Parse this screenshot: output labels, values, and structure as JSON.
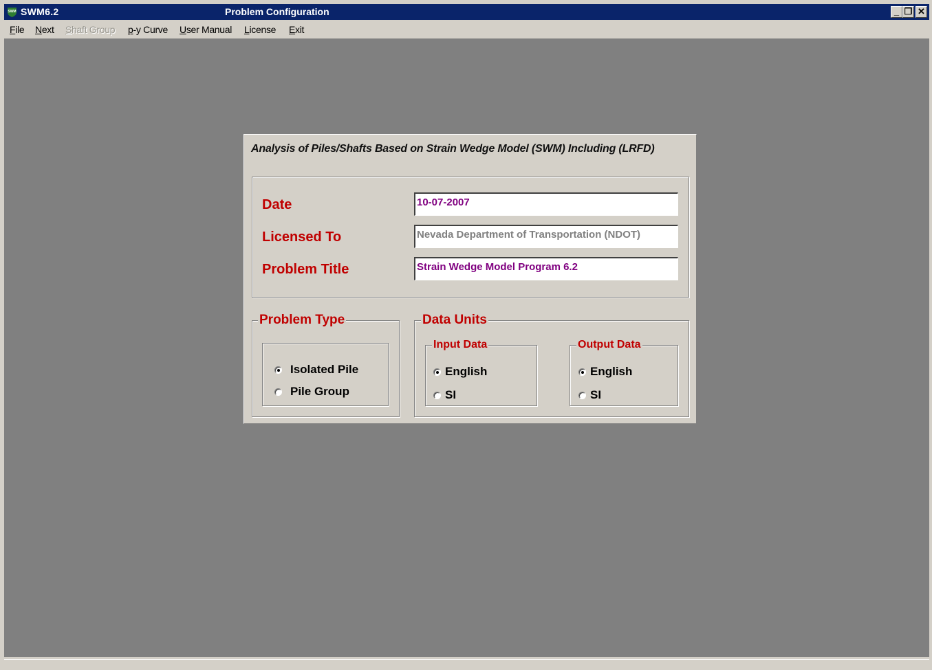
{
  "window": {
    "app_name": "SWM6.2",
    "icon_text": "SWM",
    "title": "Problem Configuration",
    "controls": {
      "minimize": "_",
      "restore": "❐",
      "close": "✕"
    }
  },
  "menu": {
    "items": [
      {
        "label": "File",
        "accel": "F",
        "rest": "ile",
        "enabled": true
      },
      {
        "label": "Next",
        "accel": "N",
        "rest": "ext",
        "enabled": true
      },
      {
        "label": "Shaft Group",
        "accel": "S",
        "rest": "haft Group",
        "enabled": false
      },
      {
        "label": "p-y Curve",
        "accel": "p",
        "rest": "-y Curve",
        "enabled": true
      },
      {
        "label": "User Manual",
        "accel": "U",
        "rest": "ser Manual",
        "enabled": true
      },
      {
        "label": "License",
        "accel": "L",
        "rest": "icense",
        "enabled": true
      },
      {
        "label": "Exit",
        "accel": "E",
        "rest": "xit",
        "enabled": true
      }
    ]
  },
  "form": {
    "heading": "Analysis of Piles/Shafts Based on Strain Wedge Model (SWM) Including (LRFD)",
    "date_label": "Date",
    "date_value": "10-07-2007",
    "licensed_label": "Licensed To",
    "licensed_value": "Nevada Department of Transportation (NDOT)",
    "title_label": "Problem Title",
    "title_value": "Strain Wedge Model Program 6.2",
    "problem_type": {
      "label": "Problem Type",
      "options": [
        "Isolated Pile",
        "Pile Group"
      ],
      "selected": "Isolated Pile"
    },
    "data_units": {
      "label": "Data Units",
      "input": {
        "label": "Input Data",
        "options": [
          "English",
          "SI"
        ],
        "selected": "English"
      },
      "output": {
        "label": "Output Data",
        "options": [
          "English",
          "SI"
        ],
        "selected": "English"
      }
    }
  },
  "colors": {
    "titlebar": "#0a246a",
    "label_red": "#c00000",
    "value_purple": "#800080",
    "value_gray": "#808080",
    "workspace": "#808080"
  }
}
